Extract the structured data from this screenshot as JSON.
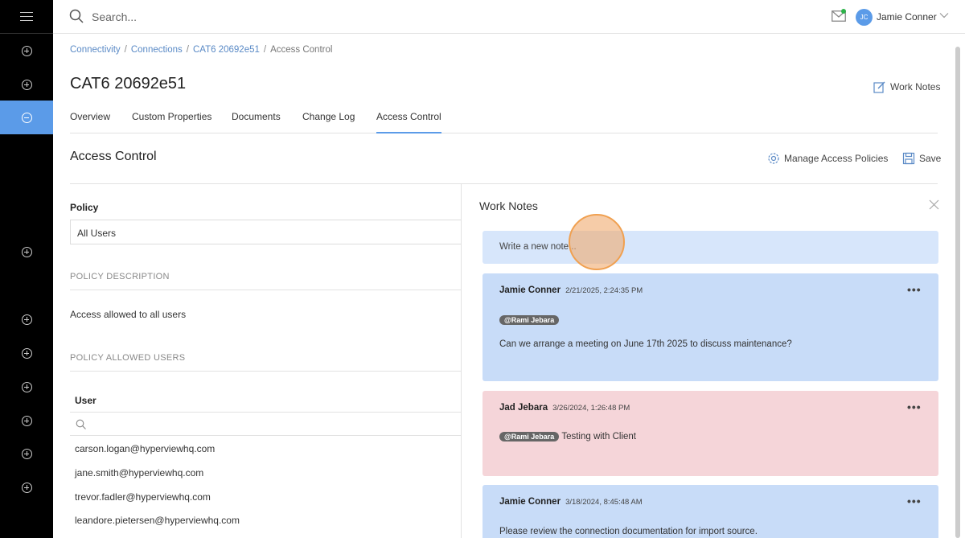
{
  "topbar": {
    "search_placeholder": "Search...",
    "user_initials": "JC",
    "user_name": "Jamie Conner"
  },
  "breadcrumb": [
    "Connectivity",
    "Connections",
    "CAT6 20692e51",
    "Access Control"
  ],
  "page": {
    "title": "CAT6 20692e51",
    "work_notes_label": "Work Notes"
  },
  "tabs": [
    "Overview",
    "Custom Properties",
    "Documents",
    "Change Log",
    "Access Control"
  ],
  "access_control": {
    "title": "Access Control",
    "manage_label": "Manage Access Policies",
    "save_label": "Save",
    "policy_label": "Policy",
    "policy_value": "All Users",
    "description_label": "POLICY DESCRIPTION",
    "description": "Access allowed to all users",
    "allowed_label": "POLICY ALLOWED USERS",
    "user_col": "User",
    "users": [
      "carson.logan@hyperviewhq.com",
      "jane.smith@hyperviewhq.com",
      "trevor.fadler@hyperviewhq.com",
      "leandore.pietersen@hyperviewhq.com"
    ]
  },
  "work_notes": {
    "title": "Work Notes",
    "placeholder": "Write a new note...",
    "notes": [
      {
        "author": "Jamie Conner",
        "time": "2/21/2025, 2:24:35 PM",
        "mention": "@Rami Jebara",
        "text": "Can we arrange a meeting on June 17th 2025 to discuss maintenance?"
      },
      {
        "author": "Jad Jebara",
        "time": "3/26/2024, 1:26:48 PM",
        "mention": "@Rami Jebara",
        "text": "Testing with Client"
      },
      {
        "author": "Jamie Conner",
        "time": "3/18/2024, 8:45:48 AM",
        "mention": "",
        "text": "Please review the connection documentation for import source."
      }
    ],
    "more_label": "•••"
  }
}
